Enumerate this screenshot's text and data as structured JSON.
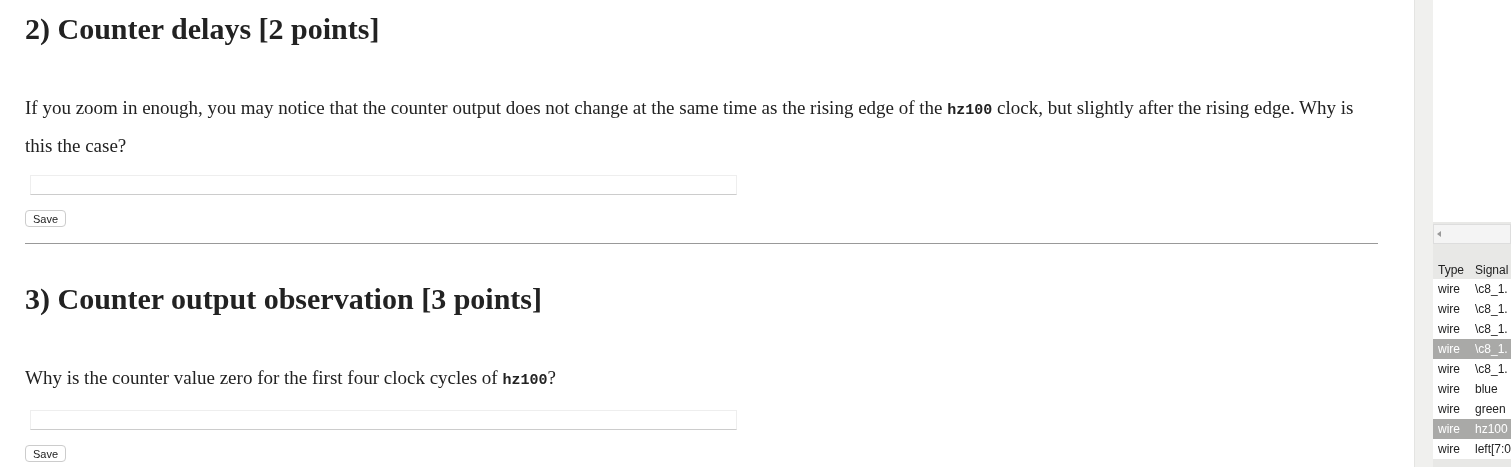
{
  "questions": [
    {
      "title": "2) Counter delays [2 points]",
      "prompt": [
        {
          "kind": "text",
          "text": "If you zoom in enough, you may notice that the counter output does not change at the same time as the rising edge of the "
        },
        {
          "kind": "code",
          "text": "hz100"
        },
        {
          "kind": "text",
          "text": " clock, but slightly after the rising edge. Why is this the case?"
        }
      ],
      "save": "Save"
    },
    {
      "title": "3) Counter output observation [3 points]",
      "prompt": [
        {
          "kind": "text",
          "text": "Why is the counter value zero for the first four clock cycles of "
        },
        {
          "kind": "code",
          "text": "hz100"
        },
        {
          "kind": "text",
          "text": "?"
        }
      ],
      "save": "Save"
    }
  ],
  "signals_panel": {
    "columns": [
      "Type",
      "Signal"
    ],
    "rows": [
      {
        "type": "wire",
        "signal": "\\c8_1.",
        "selected": false
      },
      {
        "type": "wire",
        "signal": "\\c8_1.",
        "selected": false
      },
      {
        "type": "wire",
        "signal": "\\c8_1.",
        "selected": false
      },
      {
        "type": "wire",
        "signal": "\\c8_1.",
        "selected": true
      },
      {
        "type": "wire",
        "signal": "\\c8_1.",
        "selected": false
      },
      {
        "type": "wire",
        "signal": "blue",
        "selected": false
      },
      {
        "type": "wire",
        "signal": "green",
        "selected": false
      },
      {
        "type": "wire",
        "signal": "hz100",
        "selected": true
      },
      {
        "type": "wire",
        "signal": "left[7:0",
        "selected": false
      }
    ]
  }
}
